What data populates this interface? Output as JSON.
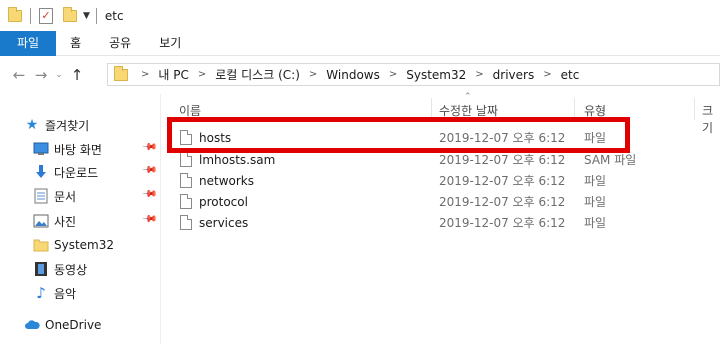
{
  "window": {
    "title": "etc"
  },
  "quick_access_toolbar": {
    "items": [
      "folder-icon",
      "properties-icon",
      "new-folder-icon",
      "customize-dropdown-icon"
    ]
  },
  "ribbon": {
    "tabs": [
      {
        "label": "파일",
        "active": true
      },
      {
        "label": "홈"
      },
      {
        "label": "공유"
      },
      {
        "label": "보기"
      }
    ],
    "file_tab_color": "#1979ca"
  },
  "address": {
    "breadcrumbs": [
      "내 PC",
      "로컬 디스크 (C:)",
      "Windows",
      "System32",
      "drivers",
      "etc"
    ]
  },
  "sidebar": {
    "quick_access_label": "즐겨찾기",
    "items": [
      {
        "label": "바탕 화면",
        "icon": "desktop-icon",
        "pinned": true
      },
      {
        "label": "다운로드",
        "icon": "download-icon",
        "pinned": true
      },
      {
        "label": "문서",
        "icon": "documents-icon",
        "pinned": true
      },
      {
        "label": "사진",
        "icon": "pictures-icon",
        "pinned": true
      },
      {
        "label": "System32",
        "icon": "folder-icon"
      },
      {
        "label": "동영상",
        "icon": "videos-icon"
      },
      {
        "label": "음악",
        "icon": "music-icon"
      }
    ],
    "onedrive_label": "OneDrive"
  },
  "file_list": {
    "columns": [
      "이름",
      "수정한 날짜",
      "유형",
      "크기"
    ],
    "rows": [
      {
        "name": "hosts",
        "date": "2019-12-07 오후 6:12",
        "type": "파일"
      },
      {
        "name": "lmhosts.sam",
        "date": "2019-12-07 오후 6:12",
        "type": "SAM 파일"
      },
      {
        "name": "networks",
        "date": "2019-12-07 오후 6:12",
        "type": "파일"
      },
      {
        "name": "protocol",
        "date": "2019-12-07 오후 6:12",
        "type": "파일"
      },
      {
        "name": "services",
        "date": "2019-12-07 오후 6:12",
        "type": "파일"
      }
    ],
    "highlighted_row": "hosts",
    "highlight_color": "#e00000"
  }
}
